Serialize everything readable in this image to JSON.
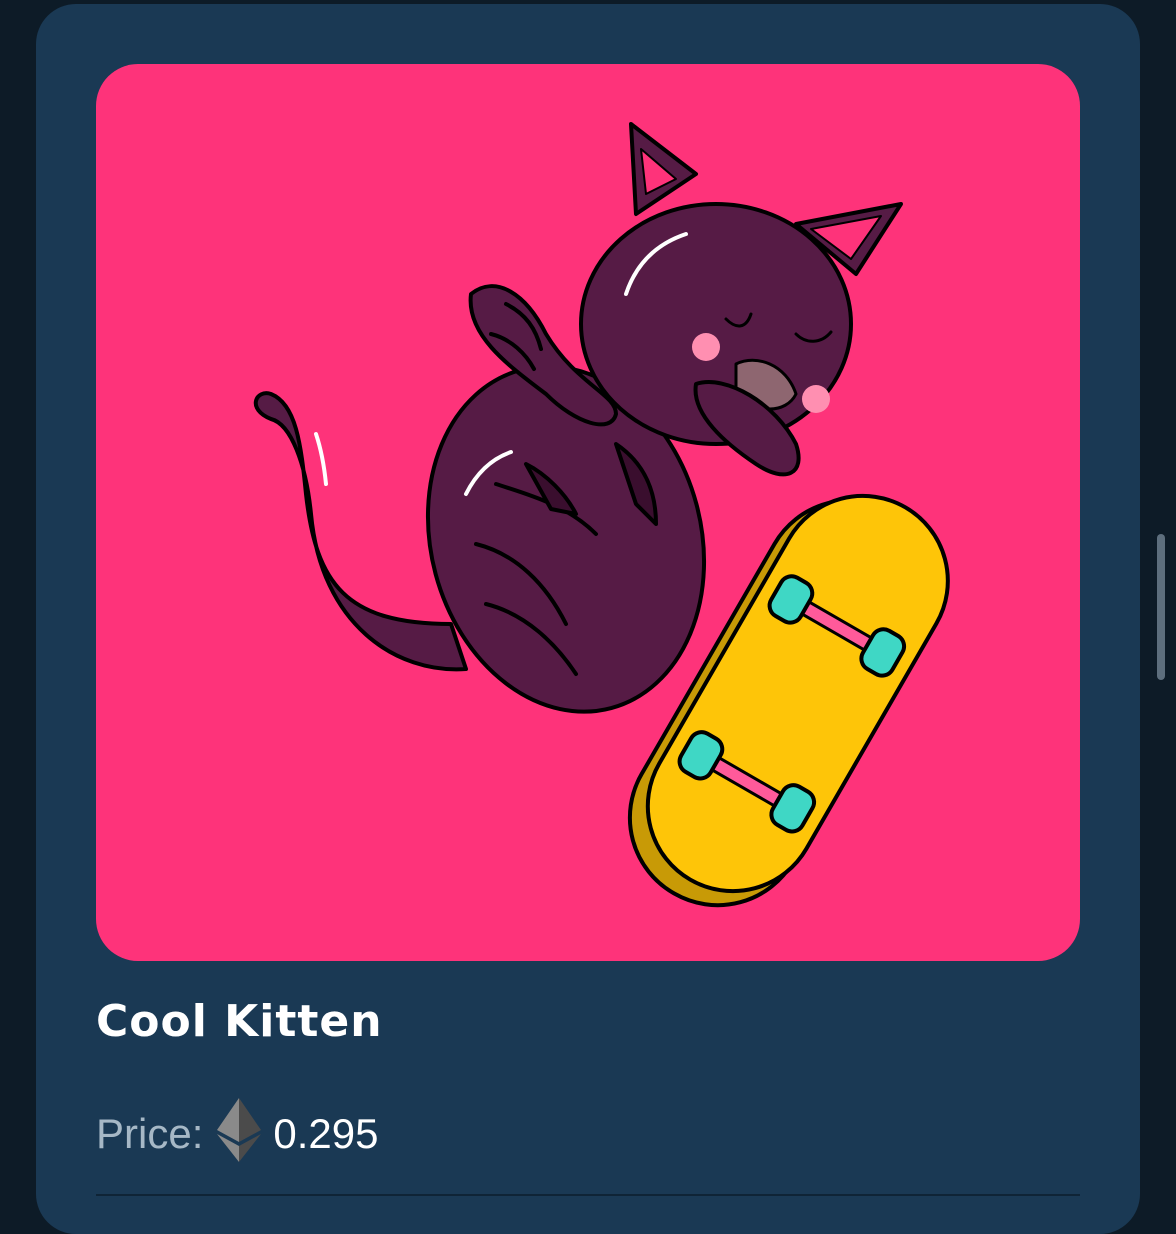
{
  "nft": {
    "title": "Cool Kitten",
    "price_label": "Price:",
    "price_value": "0.295",
    "currency_icon": "ethereum-icon",
    "artwork_description_icon": "cat-skateboard-artwork"
  },
  "colors": {
    "page_bg": "#0d1b27",
    "card_bg": "#1a3954",
    "art_bg": "#fe337a",
    "cat": "#561b45",
    "skateboard": "#fec508",
    "wheels": "#3fd7c5"
  }
}
